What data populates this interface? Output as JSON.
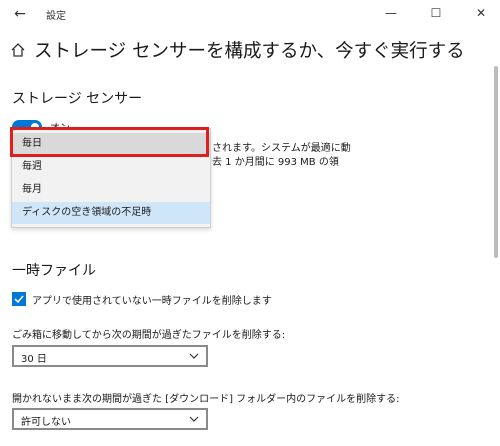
{
  "window": {
    "title": "設定",
    "back_glyph": "←",
    "minimize_glyph": "—",
    "maximize_glyph": "☐",
    "close_glyph": "✕"
  },
  "page": {
    "title": "ストレージ センサーを構成するか、今すぐ実行する"
  },
  "storage_sense": {
    "heading": "ストレージ センサー",
    "toggle_label": "オン",
    "description_line1": "されます。システムが最適に動",
    "description_line2": "去 1 か月間に 993 MB の領",
    "run_options": [
      "毎日",
      "毎週",
      "毎月",
      "ディスクの空き領域の不足時"
    ],
    "selected_option": "ディスクの空き領域の不足時",
    "highlighted_option": "毎日"
  },
  "temp_files": {
    "heading": "一時ファイル",
    "checkbox_label": "アプリで使用されていない一時ファイルを削除します",
    "recycle_label": "ごみ箱に移動してから次の期間が過ぎたファイルを削除する:",
    "recycle_value": "30 日",
    "downloads_label": "開かれないまま次の期間が過ぎた [ダウンロード] フォルダー内のファイルを削除する:",
    "downloads_value": "許可しない"
  },
  "colors": {
    "accent": "#0078d7",
    "highlight_border": "#e11e1e"
  }
}
